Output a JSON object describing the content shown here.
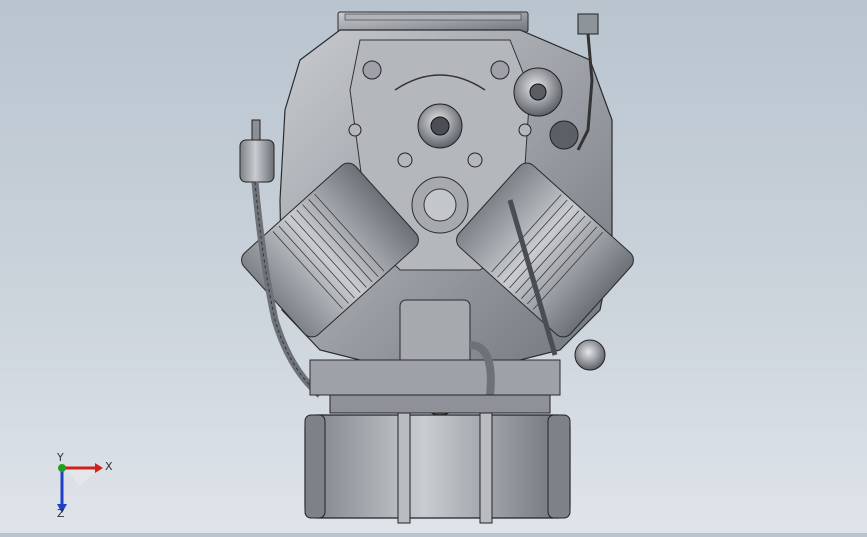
{
  "viewport": {
    "background_top": "#b9c4cf",
    "background_bottom": "#dfe4ea",
    "model_color": "#9ea2a8"
  },
  "triad": {
    "x_label": "X",
    "y_label": "Y",
    "z_label": "Z",
    "x_color": "#d02020",
    "y_color": "#1fa01f",
    "z_color": "#2040c8"
  }
}
